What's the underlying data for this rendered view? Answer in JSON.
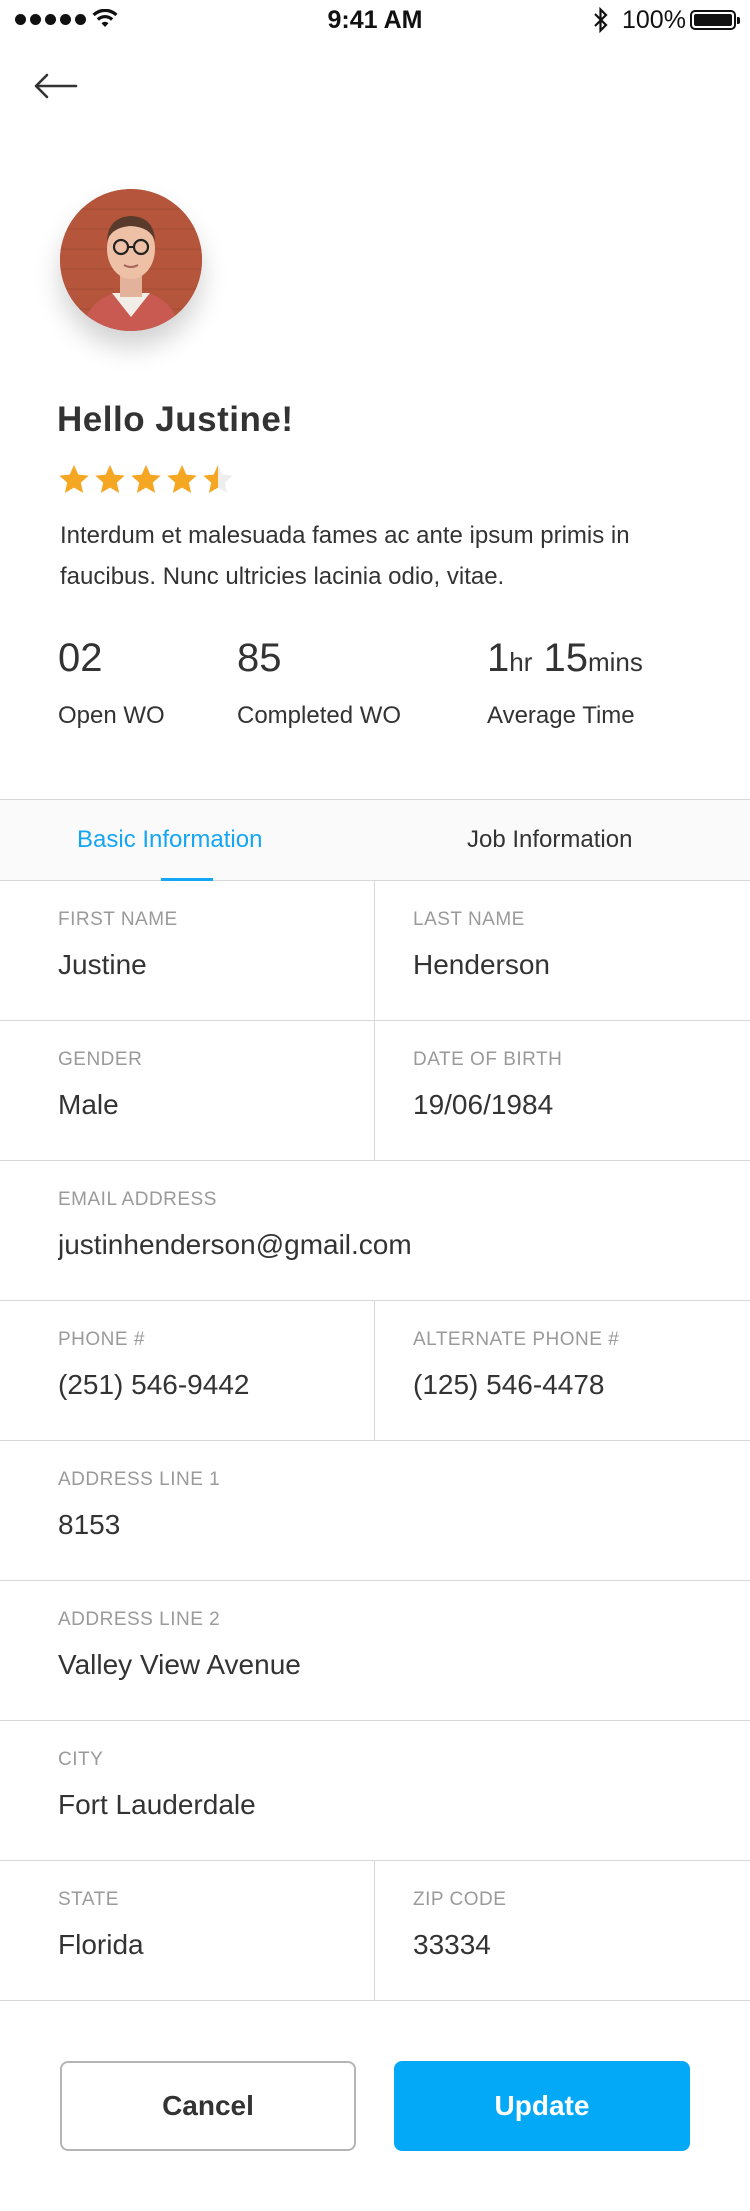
{
  "status_bar": {
    "time": "9:41 AM",
    "battery_percent": "100%",
    "icons": [
      "signal-dots-icon",
      "wifi-icon",
      "bluetooth-icon",
      "battery-icon"
    ]
  },
  "header": {
    "back_icon": "arrow-left-icon"
  },
  "profile": {
    "greeting": "Hello Justine!",
    "rating": 4.5,
    "rating_max": 5,
    "star_color": "#f5a623",
    "bio": "Interdum et malesuada fames ac ante ipsum primis in faucibus. Nunc ultricies lacinia odio, vitae."
  },
  "stats": {
    "open_wo": {
      "value": "02",
      "label": "Open WO"
    },
    "completed_wo": {
      "value": "85",
      "label": "Completed WO"
    },
    "average_time": {
      "hours": "1",
      "hours_unit": "hr",
      "minutes": "15",
      "minutes_unit": "mins",
      "label": "Average Time"
    }
  },
  "tabs": [
    {
      "label": "Basic Information",
      "active": true
    },
    {
      "label": "Job Information",
      "active": false
    }
  ],
  "form": {
    "first_name": {
      "label": "FIRST NAME",
      "value": "Justine"
    },
    "last_name": {
      "label": "LAST NAME",
      "value": "Henderson"
    },
    "gender": {
      "label": "GENDER",
      "value": "Male"
    },
    "dob": {
      "label": "DATE OF BIRTH",
      "value": "19/06/1984"
    },
    "email": {
      "label": "EMAIL ADDRESS",
      "value": "justinhenderson@gmail.com"
    },
    "phone": {
      "label": "PHONE #",
      "value": "(251) 546-9442"
    },
    "alt_phone": {
      "label": "ALTERNATE PHONE #",
      "value": "(125) 546-4478"
    },
    "address1": {
      "label": "ADDRESS LINE 1",
      "value": "8153"
    },
    "address2": {
      "label": "ADDRESS LINE 2",
      "value": "Valley View Avenue"
    },
    "city": {
      "label": "CITY",
      "value": "Fort Lauderdale"
    },
    "state": {
      "label": "STATE",
      "value": "Florida"
    },
    "zip": {
      "label": "ZIP CODE",
      "value": "33334"
    }
  },
  "actions": {
    "cancel_label": "Cancel",
    "update_label": "Update"
  },
  "colors": {
    "accent": "#14a6f5",
    "update_button": "#03a9f7",
    "star": "#f5a623"
  }
}
